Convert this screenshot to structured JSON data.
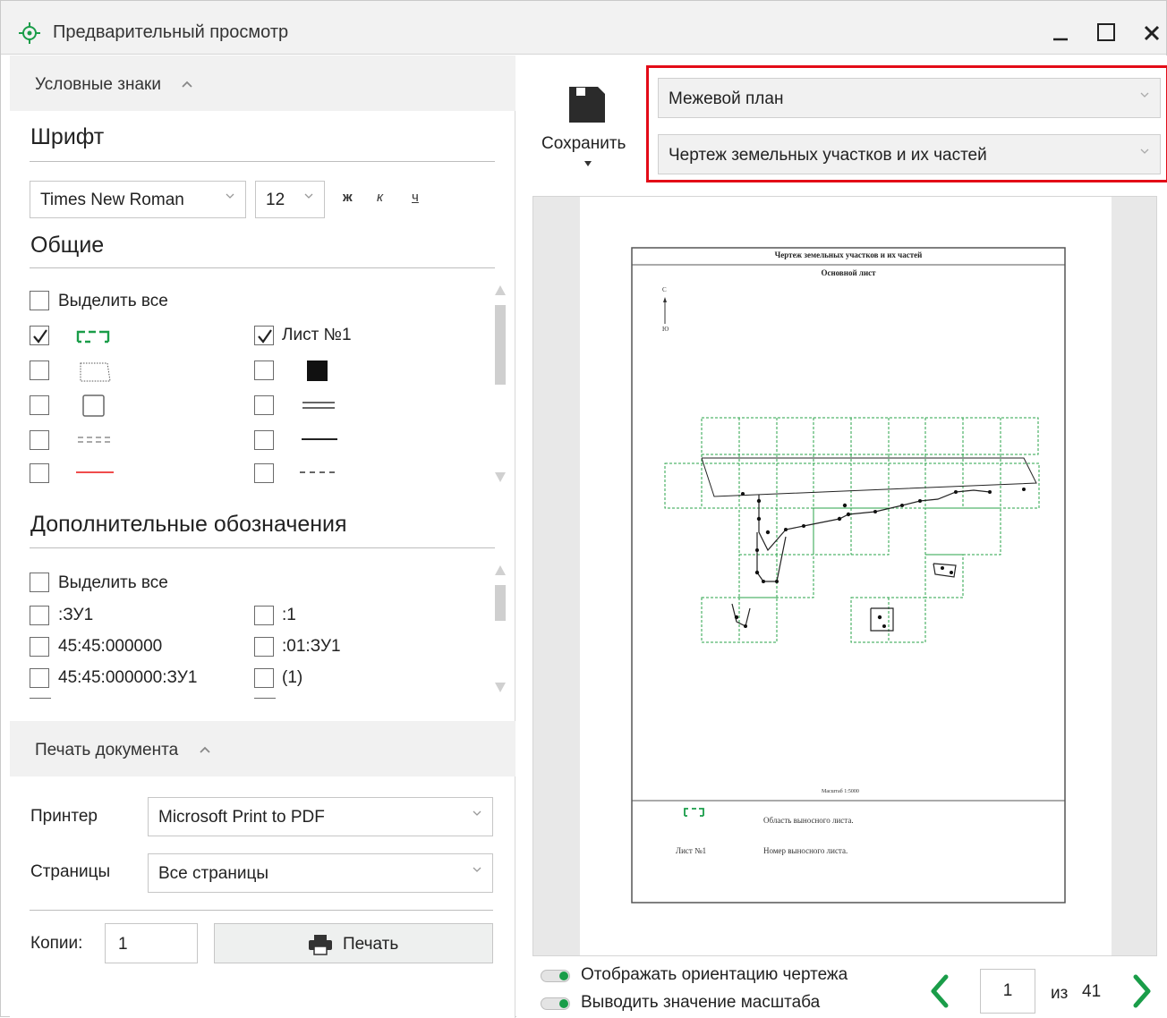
{
  "window": {
    "title": "Предварительный просмотр"
  },
  "legend_section": {
    "header": "Условные знаки",
    "font_heading": "Шрифт",
    "font_family": "Times New Roman",
    "font_size": "12",
    "bold_label": "ж",
    "italic_label": "к",
    "underline_label": "ч",
    "general_heading": "Общие",
    "select_all": "Выделить все",
    "sheet_label": "Лист №1",
    "extra_heading": "Дополнительные обозначения",
    "extra_select_all": "Выделить все",
    "extra_items": [
      ":ЗУ1",
      ":1",
      "45:45:000000",
      ":01:ЗУ1",
      "45:45:000000:ЗУ1",
      "(1)"
    ]
  },
  "print_section": {
    "header": "Печать документа",
    "printer_label": "Принтер",
    "printer_value": "Microsoft Print to PDF",
    "pages_label": "Страницы",
    "pages_value": "Все страницы",
    "copies_label": "Копии:",
    "copies_value": "1",
    "print_button": "Печать"
  },
  "toolbar": {
    "save_label": "Сохранить",
    "document_type": "Межевой план",
    "document_section": "Чертеж земельных участков и их частей"
  },
  "preview": {
    "page_title": "Чертеж земельных участков и их частей",
    "page_subtitle": "Основной лист",
    "north_top": "С",
    "north_bottom": "Ю",
    "scale_text": "Масштаб 1:5000",
    "legend_desc_1": "Область выносного листа.",
    "legend_label_2": "Лист №1",
    "legend_desc_2": "Номер выносного листа."
  },
  "footer": {
    "show_orientation": "Отображать ориентацию чертежа",
    "show_scale": "Выводить значение масштаба",
    "current_page": "1",
    "of_label": "из",
    "total_pages": "41"
  },
  "colors": {
    "accent": "#1a9d49",
    "highlight": "#e30b17"
  }
}
